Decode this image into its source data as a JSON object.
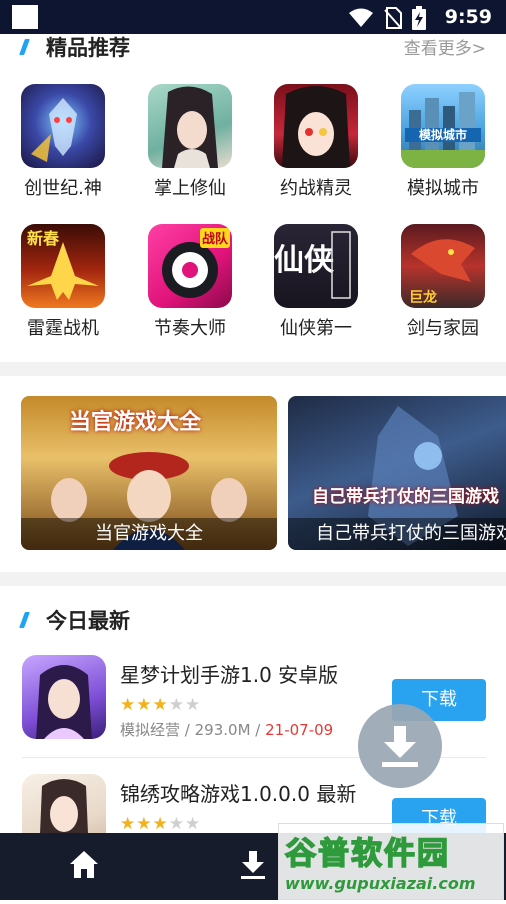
{
  "status_bar": {
    "time": "9:59"
  },
  "featured": {
    "title": "精品推荐",
    "more_label": "查看更多>",
    "apps": [
      {
        "name": "创世纪.神",
        "icon": "warrior-game-icon"
      },
      {
        "name": "掌上修仙",
        "icon": "xianxia-lady-icon"
      },
      {
        "name": "约战精灵",
        "icon": "anime-girl-icon"
      },
      {
        "name": "模拟城市",
        "icon": "city-sim-icon",
        "icon_text": "模拟城市"
      },
      {
        "name": "雷霆战机",
        "icon": "fighter-jet-icon",
        "icon_text": "新春"
      },
      {
        "name": "节奏大师",
        "icon": "rhythm-master-icon",
        "icon_text": "战队"
      },
      {
        "name": "仙侠第一",
        "icon": "calligraphy-icon",
        "icon_text": "仙侠"
      },
      {
        "name": "剑与家园",
        "icon": "dragon-icon",
        "icon_text": "巨龙"
      }
    ]
  },
  "banners": [
    {
      "caption": "当官游戏大全",
      "overlay": "当官游戏大全"
    },
    {
      "caption": "自己带兵打仗的三国游戏",
      "overlay": "自己带兵打仗的三国游戏"
    }
  ],
  "latest": {
    "title": "今日最新",
    "items": [
      {
        "title": "星梦计划手游1.0 安卓版",
        "stars": 3,
        "category": "模拟经营",
        "size": "293.0M",
        "date": "21-07-09",
        "button": "下载"
      },
      {
        "title": "锦绣攻略游戏1.0.0.0 最新",
        "stars": 3,
        "button": "下载"
      }
    ]
  },
  "watermark": {
    "logo": "谷普软件园",
    "url": "www.gupuxiazai.com"
  },
  "colors": {
    "accent": "#1fa3f4",
    "button": "#29a3f0",
    "date": "#e53935",
    "bottom_bar": "#161c2b"
  }
}
